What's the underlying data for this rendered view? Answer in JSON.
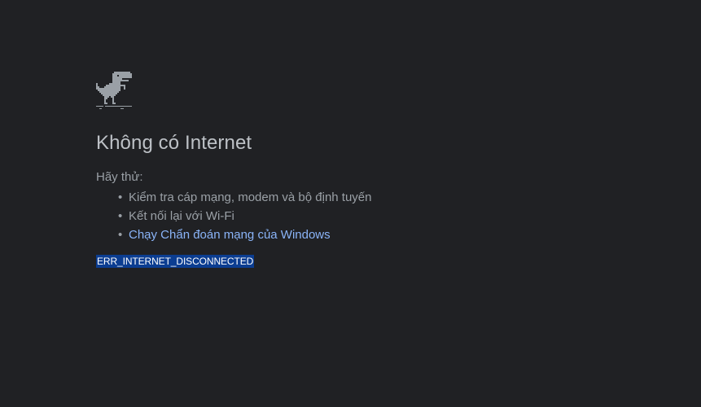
{
  "error_page": {
    "icon": "offline-dino-icon",
    "title": "Không có Internet",
    "try_label": "Hãy thử:",
    "suggestions": [
      {
        "text": "Kiểm tra cáp mạng, modem và bộ định tuyến",
        "link": false
      },
      {
        "text": "Kết nối lại với Wi-Fi",
        "link": false
      },
      {
        "text": "Chạy Chẩn đoán mạng của Windows",
        "link": true
      }
    ],
    "error_code": "ERR_INTERNET_DISCONNECTED"
  },
  "colors": {
    "background": "#202124",
    "title": "#bdc1c6",
    "text": "#9aa0a6",
    "link": "#8ab4f8",
    "selection": "#0b3d91"
  }
}
